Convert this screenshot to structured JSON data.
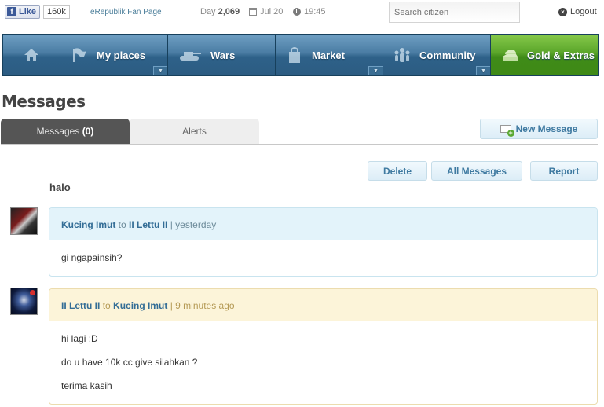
{
  "topbar": {
    "fb_like": "Like",
    "fb_count": "160k",
    "fan_page": "eRepublik Fan Page",
    "day_prefix": "Day",
    "day_number": "2,069",
    "date": "Jul 20",
    "time": "19:45",
    "search_placeholder": "Search citizen",
    "logout": "Logout"
  },
  "nav": {
    "items": [
      {
        "label": "",
        "icon": "home-icon"
      },
      {
        "label": "My places",
        "icon": "flag-icon"
      },
      {
        "label": "Wars",
        "icon": "tank-icon"
      },
      {
        "label": "Market",
        "icon": "shopping-bag-icon"
      },
      {
        "label": "Community",
        "icon": "people-icon"
      },
      {
        "label": "Gold & Extras",
        "icon": "gold-bars-icon"
      }
    ]
  },
  "page": {
    "title": "Messages",
    "tabs": {
      "messages_label": "Messages",
      "messages_count": "(0)",
      "alerts_label": "Alerts"
    },
    "new_message": "New Message",
    "actions": {
      "delete": "Delete",
      "all_messages": "All Messages",
      "report": "Report"
    },
    "subject": "halo"
  },
  "messages": [
    {
      "from": "Kucing Imut",
      "to_word": "to",
      "to": "II Lettu II",
      "time": "| yesterday",
      "lines": [
        "gi ngapainsih?"
      ]
    },
    {
      "from": "II Lettu II",
      "to_word": "to",
      "to": "Kucing Imut",
      "time": "| 9 minutes ago",
      "lines": [
        "hi lagi :D",
        "do u have 10k cc give silahkan ?",
        "terima kasih"
      ]
    }
  ],
  "colors": {
    "nav_blue": "#2e6189",
    "nav_green": "#5aa52a",
    "link_blue": "#336d96",
    "received_bg": "#e3f3fa",
    "sent_bg": "#fcf4d9"
  }
}
